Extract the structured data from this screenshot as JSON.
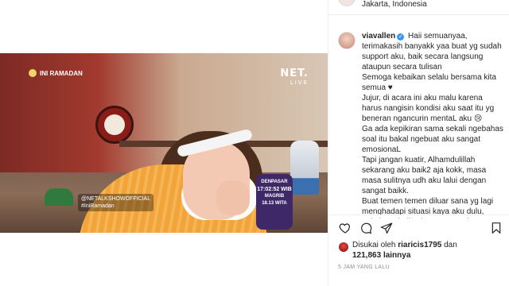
{
  "post": {
    "location": "Jakarta, Indonesia",
    "username": "viavallen",
    "caption_lines": [
      "Haii semuanyaa,",
      "terimakasih banyakk yaa buat yg sudah support aku, baik secara langsung ataupun secara tulisan",
      "Semoga kebaikan selalu bersama kita semua ♥",
      "Jujur, di acara ini aku malu karena harus nangisin kondisi aku saat itu yg beneran ngancurin mentaL aku 😢",
      "Ga ada kepikiran sama sekali ngebahas soal itu bakal ngebuat aku sangat emosionaL",
      "Tapi jangan kuatir, Alhamdulillah sekarang aku baik2 aja kokk, masa masa sulitnya udh aku lalui dengan sangat baikk.",
      "Buat temen temen diluar sana yg lagi menghadapi situasi kaya aku dulu, pokoknya kalian jangan nyerah sama"
    ],
    "liked_by_prefix": "Disukai oleh",
    "liked_by_user": "riaricis1795",
    "liked_by_and": "dan",
    "likes_count": "121,863",
    "likes_suffix": "lainnya",
    "time_ago": "5 JAM YANG LALU"
  },
  "video": {
    "badge_text": "INI RAMADAN",
    "channel_logo": "NET.",
    "channel_live": "LIVE",
    "handle_text": "@NETALKSHOWOFFICIAL",
    "handle_text2": "#IniRamadan",
    "timer_city": "DENPASAR",
    "timer_time": "17:02:52 WIB",
    "timer_label": "MAGRIB",
    "timer_countdown": "18.13 WITA"
  },
  "icons": {
    "like": "heart-icon",
    "comment": "comment-icon",
    "share": "share-icon",
    "save": "bookmark-icon"
  },
  "colors": {
    "accent_blue": "#3897f0",
    "text": "#262626",
    "muted": "#8e8e8e"
  }
}
